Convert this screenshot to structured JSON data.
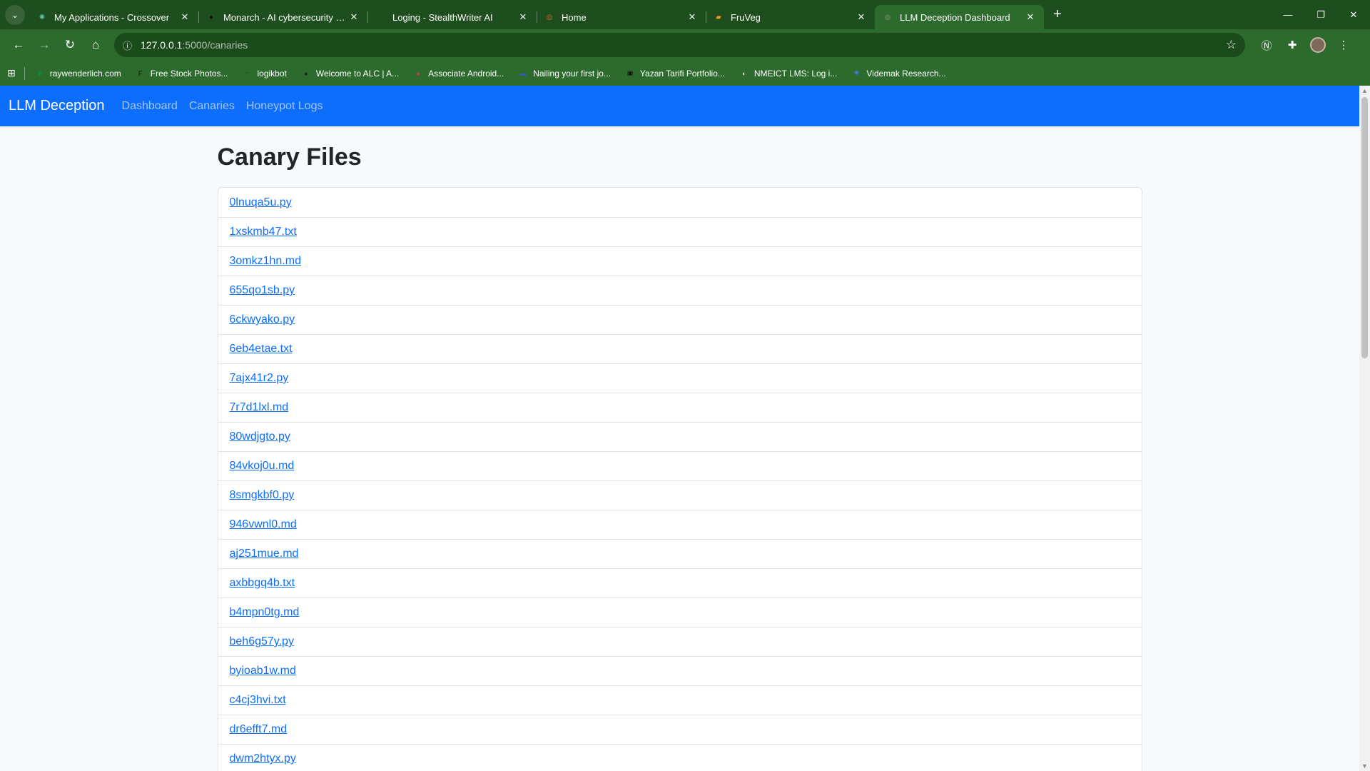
{
  "browser": {
    "tabs": [
      {
        "title": "My Applications - Crossover",
        "icon": "crossover-icon",
        "color": "#5ec2a0",
        "glyph": "✺",
        "active": false
      },
      {
        "title": "Monarch - AI cybersecurity proj",
        "icon": "monarch-icon",
        "color": "#111111",
        "glyph": "●",
        "active": false
      },
      {
        "title": "Loging - StealthWriter AI",
        "icon": "loading-spinner-icon",
        "color": "#1e4d1e",
        "glyph": "◌",
        "active": false
      },
      {
        "title": "Home",
        "icon": "home-site-icon",
        "color": "#e0702a",
        "glyph": "◎",
        "active": false
      },
      {
        "title": "FruVeg",
        "icon": "fruveg-icon",
        "color": "#f59b1c",
        "glyph": "▰",
        "active": false
      },
      {
        "title": "LLM Deception Dashboard",
        "icon": "globe-icon",
        "color": "#6b8f6b",
        "glyph": "◍",
        "active": true
      }
    ],
    "url_host": "127.0.0.1",
    "url_path": ":5000/canaries",
    "bookmarks": [
      {
        "label": "raywenderlich.com",
        "icon": "raywenderlich-icon",
        "color": "#0b8a3e",
        "glyph": "▮"
      },
      {
        "label": "Free Stock Photos...",
        "icon": "freestock-icon",
        "color": "#111111",
        "glyph": "F"
      },
      {
        "label": "logikbot",
        "icon": "logikbot-icon",
        "color": "#1e4d1e",
        "glyph": "⌁"
      },
      {
        "label": "Welcome to ALC | A...",
        "icon": "alc-icon",
        "color": "#222222",
        "glyph": "●"
      },
      {
        "label": "Associate Android...",
        "icon": "android-icon",
        "color": "#d9335b",
        "glyph": "●"
      },
      {
        "label": "Nailing your first jo...",
        "icon": "nailing-icon",
        "color": "#3558c9",
        "glyph": "▬"
      },
      {
        "label": "Yazan Tarifi Portfolio...",
        "icon": "portfolio-icon",
        "color": "#111111",
        "glyph": "▣"
      },
      {
        "label": "NMEICT LMS: Log i...",
        "icon": "nmeict-icon",
        "color": "#eeeeee",
        "glyph": "◐"
      },
      {
        "label": "Videmak Research...",
        "icon": "videmak-icon",
        "color": "#3d7be0",
        "glyph": "✺"
      }
    ]
  },
  "navbar": {
    "brand": "LLM Deception",
    "links": [
      "Dashboard",
      "Canaries",
      "Honeypot Logs"
    ]
  },
  "page": {
    "title": "Canary Files",
    "files": [
      "0lnuqa5u.py",
      "1xskmb47.txt",
      "3omkz1hn.md",
      "655qo1sb.py",
      "6ckwyako.py",
      "6eb4etae.txt",
      "7ajx41r2.py",
      "7r7d1lxl.md",
      "80wdjgto.py",
      "84vkoj0u.md",
      "8smgkbf0.py",
      "946vwnl0.md",
      "aj251mue.md",
      "axbbgq4b.txt",
      "b4mpn0tg.md",
      "beh6g57y.py",
      "byioab1w.md",
      "c4cj3hvi.txt",
      "dr6efft7.md",
      "dwm2htyx.py"
    ]
  },
  "colors": {
    "chrome_dark": "#1e4d1e",
    "chrome": "#2d6a2d",
    "navbar": "#0d6efd",
    "link": "#0d6efd"
  }
}
